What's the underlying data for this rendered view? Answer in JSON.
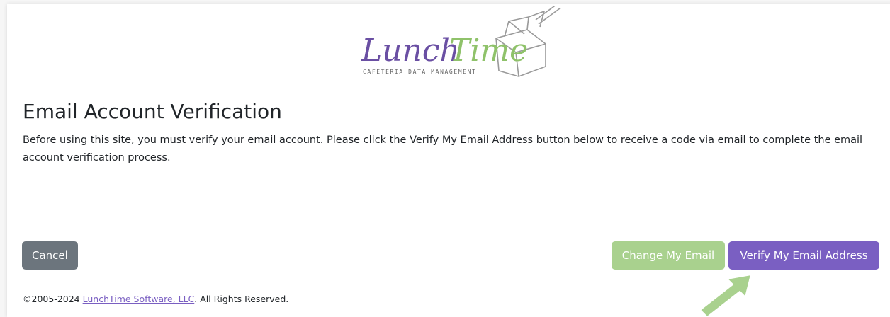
{
  "logo": {
    "text_dark": "Lunch",
    "text_light": "Time",
    "tagline": "CAFETERIA DATA MANAGEMENT"
  },
  "page": {
    "title": "Email Account Verification",
    "description": "Before using this site, you must verify your email account. Please click the Verify My Email Address button below to receive a code via email to complete the email account verification process."
  },
  "buttons": {
    "cancel_label": "Cancel",
    "change_email_label": "Change My Email",
    "verify_label": "Verify My Email Address"
  },
  "footer": {
    "copyright_prefix": "©2005-2024 ",
    "company_link": "LunchTime Software, LLC",
    "copyright_suffix": ". All Rights Reserved."
  },
  "colors": {
    "brand_purple": "#7a5fc2",
    "brand_green": "#a9d18e",
    "cancel_gray": "#6c757d",
    "arrow_green": "#a9d18e"
  },
  "icons": {
    "logo_graphic": "lunchbox-icon",
    "pointer": "arrow-pointer-icon"
  }
}
